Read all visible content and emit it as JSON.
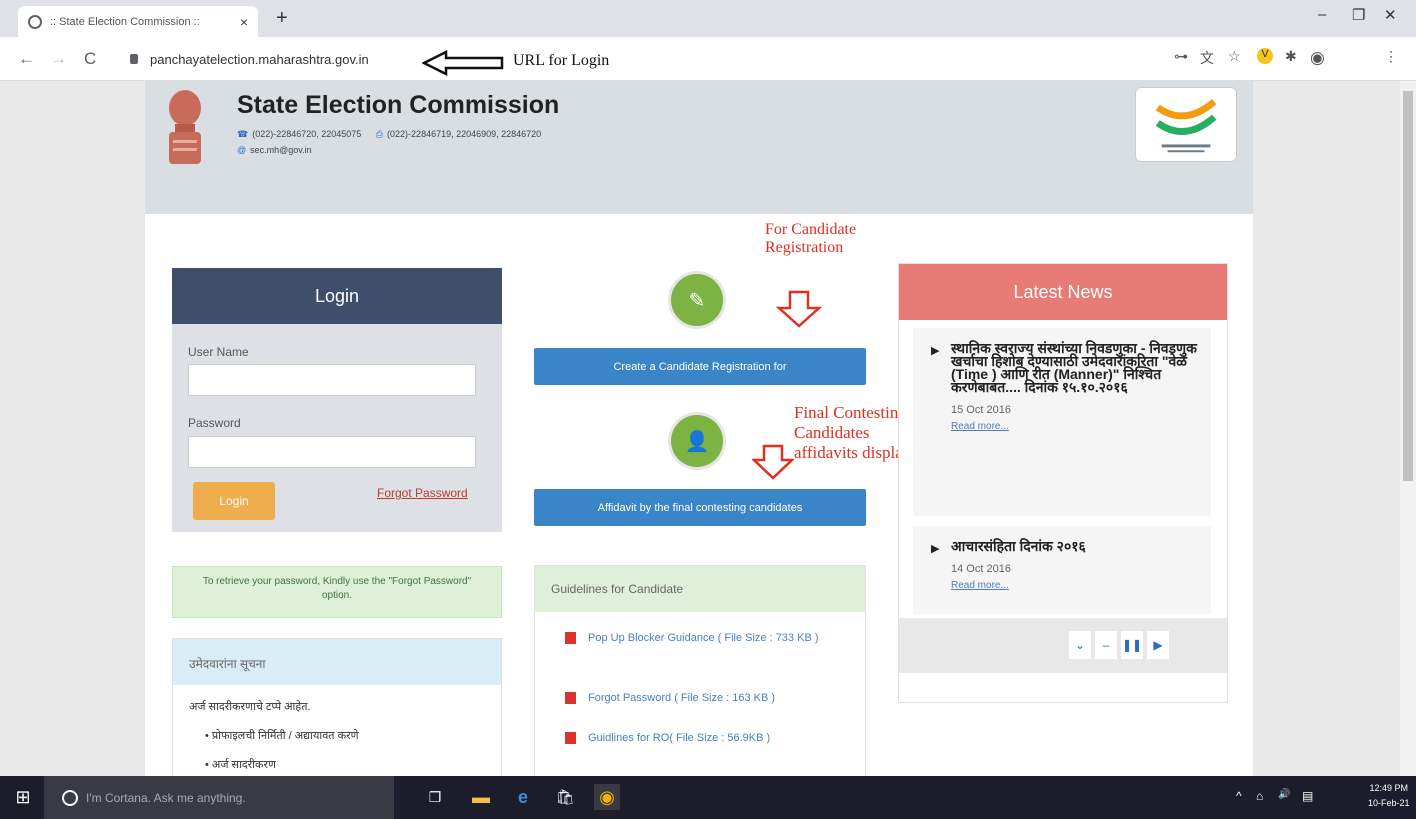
{
  "browser": {
    "tab_title": ":: State Election Commission :: ",
    "tab_close": "×",
    "new_tab": "+",
    "url": "panchayatelection.maharashtra.gov.in",
    "nav_back": "←",
    "nav_forward": "→",
    "nav_reload": "C",
    "win_minimize": "–",
    "win_restore": "❐",
    "win_close": "✕",
    "ext_key": "⊶",
    "ext_translate": "文",
    "ext_star": "☆",
    "ext_v": "V",
    "ext_puzzle": "✱",
    "ext_profile": "◉",
    "ext_menu": "⋮"
  },
  "annotations": {
    "url_login": "URL for Login",
    "candidate_registration": "For Candidate\nRegistration",
    "final_contesting": "Final Contesting\nCandidates\naffidavits display"
  },
  "header": {
    "title": "State Election Commission",
    "phone": "(022)-22846720, 22045075",
    "fax": "(022)-22846719, 22046909, 22846720",
    "email": "sec.mh@gov.in",
    "phone_icon": "☎",
    "fax_icon": "⎙",
    "email_icon": "@"
  },
  "login": {
    "heading": "Login",
    "username_label": "User Name",
    "password_label": "Password",
    "login_button": "Login",
    "forgot_link": "Forgot Password"
  },
  "retrieve_note": "To retrieve your password, Kindly use the \"Forgot Password\" option.",
  "notice": {
    "heading": "उमेदवारांना सूचना",
    "text": "अर्ज सादरीकरणाचे टप्पे आहेत.",
    "items": [
      "प्रोफाइलची निर्मिती / अद्यायावत करणे",
      "अर्ज सादरीकरण"
    ],
    "bullet": "•"
  },
  "middle": {
    "pencil_icon": "✎",
    "person_icon": "👤",
    "create_button": "Create a Candidate Registration for",
    "affidavit_button": "Affidavit by the final contesting candidates"
  },
  "guidelines": {
    "heading": "Guidelines for Candidate",
    "items": [
      "Pop Up Blocker Guidance ( File Size : 733 KB )",
      "Forgot Password ( File Size : 163 KB )",
      "Guidlines for RO( File Size : 56.9KB )"
    ]
  },
  "news": {
    "heading": "Latest News",
    "bullet": "▶",
    "items": [
      {
        "title": "स्थानिक स्वराज्य संस्थांच्या निवडणुका - निवडणुक खर्चाचा हिशोब देण्यासाठी उमेदवारांकरिता \"वेळ (Time ) आणि रीत (Manner)\" निश्चित करणेबाबत.... दिनांक १५.१०.२०१६",
        "date": "15 Oct 2016",
        "more": "Read more..."
      },
      {
        "title": "आचारसंहिता दिनांक २०१६",
        "date": "14 Oct 2016",
        "more": "Read more..."
      }
    ],
    "controls": [
      "⌄",
      "–",
      "❚❚",
      "▶"
    ]
  },
  "taskbar": {
    "search_placeholder": "I'm Cortana. Ask me anything.",
    "win_icon": "⊞",
    "taskview_icon": "❐",
    "explorer_icon": "▬",
    "edge_icon": "e",
    "store_icon": "🛍",
    "chrome_icon": "◉",
    "tray_caret": "^",
    "tray_network": "⌂",
    "tray_sound": "🔊",
    "tray_notification": "▤",
    "time": "12:49 PM",
    "date": "10-Feb-21"
  },
  "colors": {
    "login_header": "#3f4e6b",
    "news_header": "#e87b76",
    "blue_button": "#3a84c8",
    "green_circle": "#7cb342",
    "annotation_red": "#e03020"
  }
}
